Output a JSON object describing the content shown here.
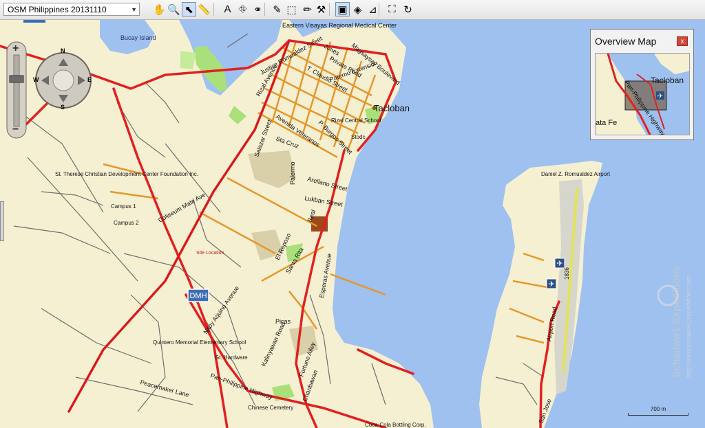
{
  "toolbar": {
    "map_name": "OSM Philippines 20131110",
    "tools": [
      {
        "name": "pan-hand-icon",
        "glyph": "✋"
      },
      {
        "name": "zoom-magnifier-icon",
        "glyph": "🔍"
      },
      {
        "name": "select-arrow-icon",
        "glyph": "⬉"
      },
      {
        "name": "measure-ruler-icon",
        "glyph": "📏"
      },
      {
        "name": "find-place-icon",
        "glyph": "A"
      },
      {
        "name": "route-icon",
        "glyph": "⛗"
      },
      {
        "name": "waypoints-icon",
        "glyph": "⚭"
      },
      {
        "name": "new-waypoint-icon",
        "glyph": "✎"
      },
      {
        "name": "area-select-icon",
        "glyph": "⬚"
      },
      {
        "name": "pencil-icon",
        "glyph": "✏"
      },
      {
        "name": "tools-icon",
        "glyph": "⚒"
      },
      {
        "name": "map-2d-icon",
        "glyph": "▣"
      },
      {
        "name": "map-3d-icon",
        "glyph": "◈"
      },
      {
        "name": "layers-icon",
        "glyph": "⊿"
      },
      {
        "name": "fit-map-icon",
        "glyph": "⛶"
      },
      {
        "name": "refresh-map-icon",
        "glyph": "↻"
      }
    ]
  },
  "map": {
    "city_label": "Tacloban",
    "labels": [
      "Eastern Visayas Regional Medical Center",
      "Bucay Island",
      "Justice Romualdez Street",
      "Jones",
      "Magsaysay Boulevard",
      "Private Road",
      "T. Claudio Street",
      "Rizal Avenue",
      "Paterno Extension",
      "Tacloban",
      "Rizal Central School",
      "Avenida Veteranos",
      "P. Burgos Street",
      "Salazar Street",
      "Sta Cruz",
      "Stodc",
      "St. Therese Christian Development Center Foundation Inc.",
      "Palermo",
      "Arellano Street",
      "Lukban Street",
      "Campus 1",
      "Campus 2",
      "Coliseum Mate Ave",
      "Real",
      "El Reposo",
      "Site Location",
      "Santa Rita",
      "Esperas Avenue",
      "Nitoy Aquino Avenue",
      "DMH",
      "Picas",
      "Fortune Alley",
      "Quintero Memorial Elementary School",
      "Kalinyawan Road",
      "Gt. Hardware",
      "Peacemaker Lane",
      "Pan-Philippine Highway",
      "Chanbawan",
      "Chinese Cemetery",
      "Coca-Cola Bottling Corp.",
      "Daniel Z. Romualdez Airport",
      "Airport Road",
      "1836",
      "San Jose"
    ],
    "scale_label": "700 m",
    "watermark": [
      "Schadow1 Expeditions",
      "http://www.schadow1expeditions.com"
    ]
  },
  "overview": {
    "title": "Overview Map",
    "close_glyph": "x",
    "labels": [
      "Tacloban",
      "Pan-Philippine Highway",
      "ata Fe"
    ]
  },
  "nav": {
    "north": "N",
    "south": "S",
    "east": "E",
    "west": "W",
    "zoom_in": "+",
    "zoom_out": "−"
  },
  "colors": {
    "land": "#f6f0d3",
    "water": "#9ec1ef",
    "major_road": "#e22020",
    "secondary_road": "#e8962a",
    "minor_road": "#6e6e6e",
    "park": "#a9e07a",
    "urban": "#d9cfa8"
  }
}
